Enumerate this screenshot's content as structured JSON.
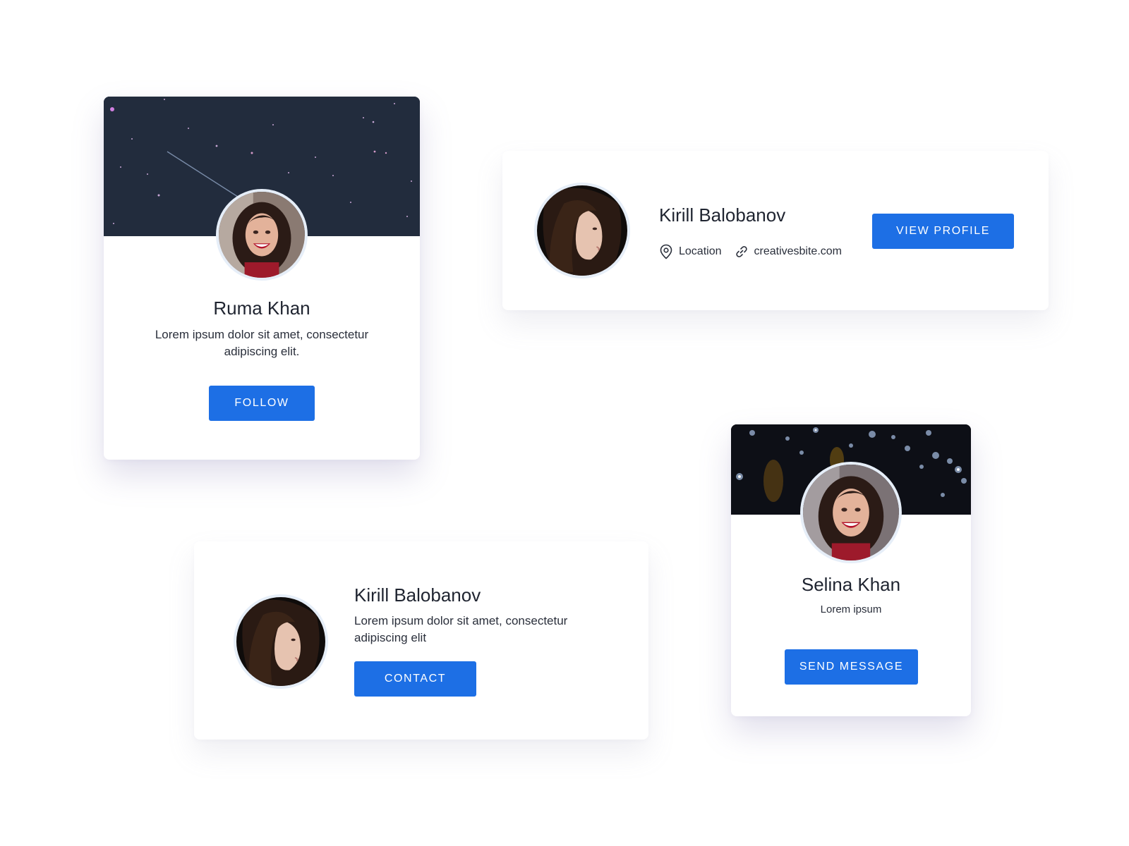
{
  "cards": {
    "profile_card_1": {
      "name": "Ruma Khan",
      "description": "Lorem ipsum dolor sit amet, consectetur adipiscing elit.",
      "button_label": "FOLLOW"
    },
    "profile_card_2": {
      "name": "Kirill Balobanov",
      "location_label": "Location",
      "website_label": "creativesbite.com",
      "button_label": "VIEW PROFILE"
    },
    "profile_card_3": {
      "name": "Kirill Balobanov",
      "description": "Lorem ipsum dolor sit amet, consectetur adipiscing elit",
      "button_label": "CONTACT"
    },
    "profile_card_4": {
      "name": "Selina Khan",
      "subtitle": "Lorem ipsum",
      "button_label": "SEND MESSAGE"
    }
  },
  "colors": {
    "accent": "#1d6fe5",
    "night_banner": "#222c3d",
    "bokeh_banner": "#0d0f16"
  },
  "icons": {
    "location": "map-pin-icon",
    "website": "link-icon"
  }
}
